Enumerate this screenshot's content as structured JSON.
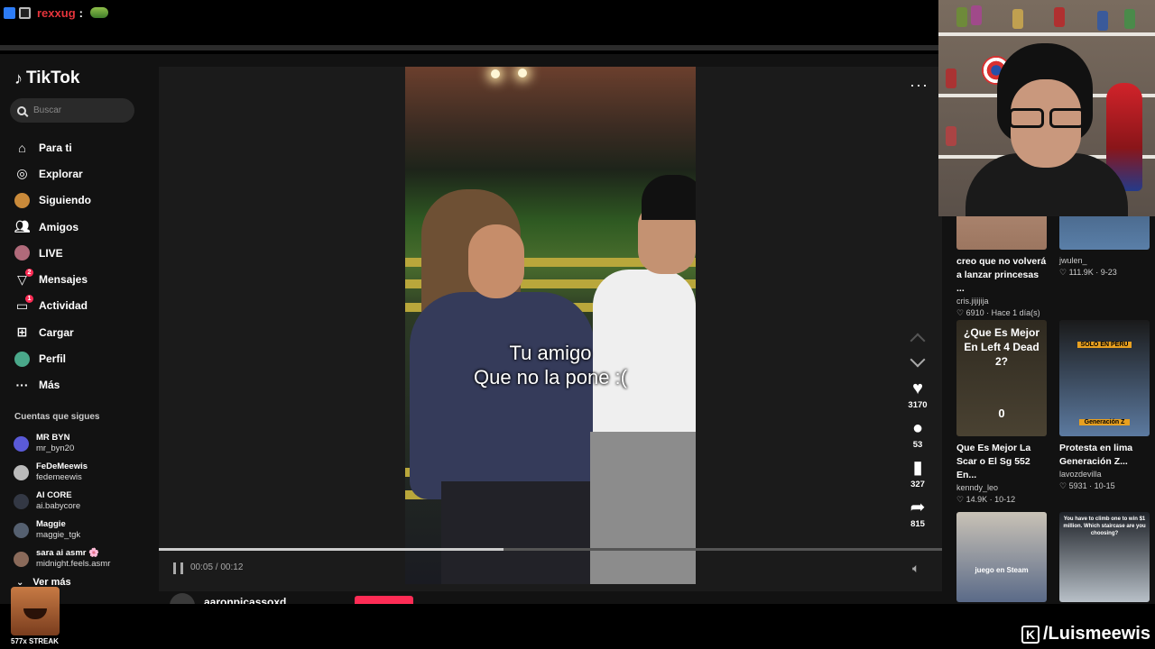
{
  "chat": {
    "username": "rexxug",
    "separator": ":"
  },
  "sidebar": {
    "logo": "TikTok",
    "search_placeholder": "Buscar",
    "nav": [
      {
        "label": "Para ti",
        "icon": "home-icon"
      },
      {
        "label": "Explorar",
        "icon": "compass-icon"
      },
      {
        "label": "Siguiendo",
        "icon": "following-avatar-icon"
      },
      {
        "label": "Amigos",
        "icon": "friends-icon"
      },
      {
        "label": "LIVE",
        "icon": "live-avatar-icon"
      },
      {
        "label": "Mensajes",
        "icon": "messages-icon",
        "badge": "2"
      },
      {
        "label": "Actividad",
        "icon": "activity-icon",
        "badge": "1"
      },
      {
        "label": "Cargar",
        "icon": "upload-icon"
      },
      {
        "label": "Perfil",
        "icon": "profile-avatar-icon"
      },
      {
        "label": "Más",
        "icon": "more-dots-icon"
      }
    ],
    "following_title": "Cuentas que sigues",
    "following": [
      {
        "name": "MR BYN",
        "handle": "mr_byn20",
        "color": "#5a5ad8"
      },
      {
        "name": "FeDeMeewis",
        "handle": "fedemeewis",
        "color": "#bbbbbb"
      },
      {
        "name": "AI CORE",
        "handle": "ai.babycore",
        "color": "#333844"
      },
      {
        "name": "Maggie",
        "handle": "maggie_tgk",
        "color": "#556070"
      },
      {
        "name": "sara ai asmr 🌸",
        "handle": "midnight.feels.asmr",
        "color": "#8a6a5a"
      }
    ],
    "see_more": "Ver más"
  },
  "video": {
    "caption_line1": "Tu amigo",
    "caption_line2": "Que no la pone :(",
    "likes": "3170",
    "comments": "53",
    "saves": "327",
    "shares": "815",
    "time": "00:05 / 00:12",
    "progress": 0.44,
    "author": "aaronpicassoxd"
  },
  "feed": [
    {
      "title": "creo que no volverá a lanzar princesas ...",
      "user": "cris.jijijija",
      "stat": "♡ 6910 · Hace 1 día(s)",
      "thumb_text": "",
      "colors": [
        "#c8a08a",
        "#9c7660"
      ]
    },
    {
      "title": "",
      "user": "jwulen_",
      "stat": "♡ 111.9K · 9-23",
      "thumb_text": "",
      "colors": [
        "#2a3c55",
        "#5a7fa8"
      ]
    },
    {
      "title": "Que Es Mejor La Scar o El Sg 552 En...",
      "user": "kenndy_leo",
      "stat": "♡ 14.9K · 10-12",
      "thumb_text": "¿Que Es Mejor En Left 4 Dead 2?",
      "thumb_sub": "0",
      "colors": [
        "#2f2a20",
        "#4a4232"
      ]
    },
    {
      "title": "Protesta en lima Generación Z...",
      "user": "lavozdevilla",
      "stat": "♡ 5931 · 10-15",
      "thumb_text": "SOLO EN PERU",
      "thumb_sub": "Generación Z",
      "colors": [
        "#1a1a1a",
        "#5c7aa0"
      ]
    },
    {
      "title": "",
      "user": "",
      "stat": "",
      "thumb_text": "juego en Steam",
      "colors": [
        "#c9c2b6",
        "#5a6a88"
      ]
    },
    {
      "title": "",
      "user": "",
      "stat": "",
      "thumb_text": "You have to climb one to win $1 million. Which staircase are you choosing?",
      "colors": [
        "#1e2228",
        "#b8c0c8"
      ]
    }
  ],
  "overlay": {
    "streak": "577x STREAK",
    "kick_handle": "/Luismeewis"
  },
  "colors": {
    "accent": "#fe2c55",
    "background": "#121212",
    "chat_user": "#e5343b"
  }
}
